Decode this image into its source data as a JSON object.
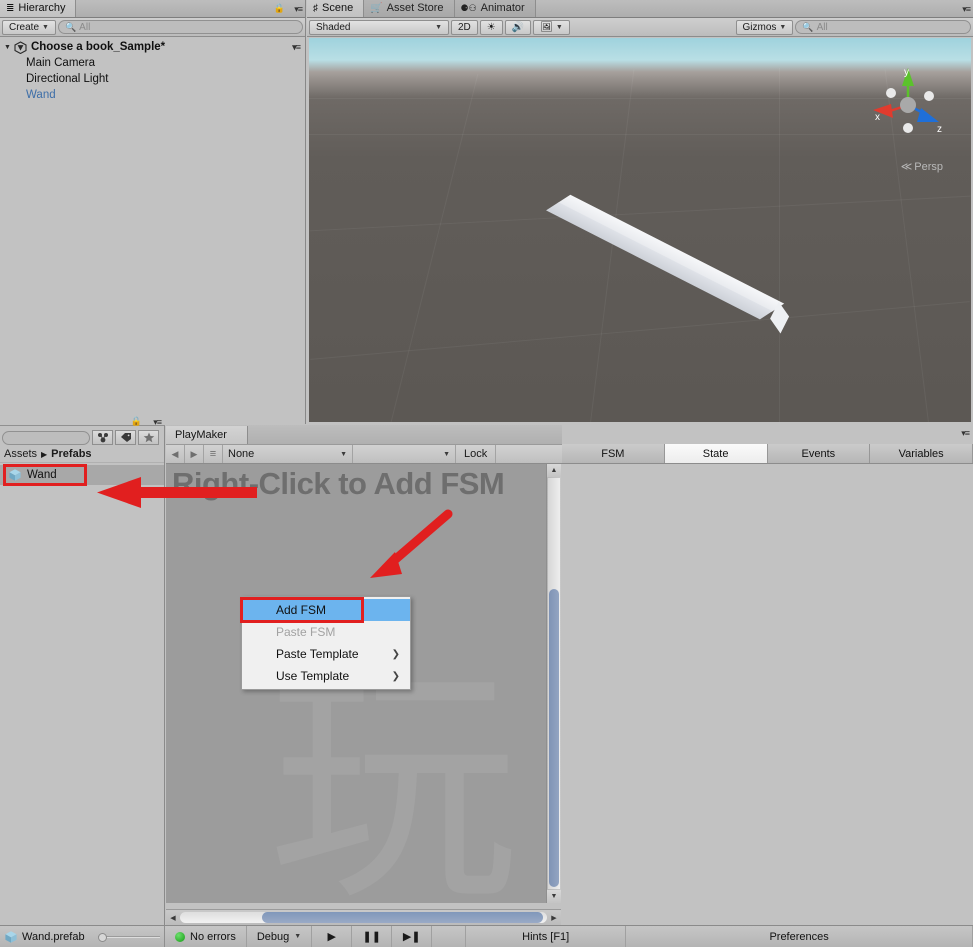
{
  "hierarchy": {
    "tab_label": "Hierarchy",
    "tab_icon": "hierarchy-icon",
    "create_label": "Create",
    "search_placeholder": "All",
    "root_label": "Choose a book_Sample*",
    "items": [
      {
        "label": "Main Camera",
        "kind": "gameobject"
      },
      {
        "label": "Directional Light",
        "kind": "gameobject"
      },
      {
        "label": "Wand",
        "kind": "prefab"
      }
    ]
  },
  "scene": {
    "tabs": [
      {
        "label": "Scene",
        "icon": "scene-icon",
        "active": true
      },
      {
        "label": "Asset Store",
        "icon": "store-icon",
        "active": false
      },
      {
        "label": "Animator",
        "icon": "animator-icon",
        "active": false
      }
    ],
    "toolbar": {
      "draw_mode": "Shaded",
      "two_d": "2D",
      "light_icon": "sun-icon",
      "audio_icon": "speaker-icon",
      "fx_icon": "image-icon",
      "gizmos_label": "Gizmos",
      "search_placeholder": "All"
    },
    "gizmo": {
      "x_label": "x",
      "y_label": "y",
      "z_label": "z",
      "projection_label": "Persp",
      "x_color": "#e03b2e",
      "y_color": "#5bc22b",
      "z_color": "#1f6fd8"
    }
  },
  "project": {
    "search_placeholder": "",
    "icons": [
      "favorite-folder-icon",
      "label-icon",
      "star-icon"
    ],
    "breadcrumb": [
      "Assets",
      "Prefabs"
    ],
    "assets": [
      {
        "label": "Wand",
        "icon": "prefab-cube-icon",
        "selected": true
      }
    ]
  },
  "playmaker": {
    "tab_label": "PlayMaker",
    "toolbar": {
      "back_icon": "arrow-left-icon",
      "forward_icon": "arrow-right-icon",
      "list_icon": "list-icon",
      "selected_object": "None",
      "fsm_dropdown": "",
      "lock_label": "Lock",
      "settings_icon": "preset-icon"
    },
    "graph": {
      "hint_text": "Right-Click to Add FSM",
      "watermark_glyph": "玩"
    },
    "context_menu": {
      "items": [
        {
          "label": "Add FSM",
          "state": "selected",
          "submenu": false
        },
        {
          "label": "Paste FSM",
          "state": "disabled",
          "submenu": false
        },
        {
          "label": "Paste Template",
          "state": "normal",
          "submenu": true
        },
        {
          "label": "Use Template",
          "state": "normal",
          "submenu": true
        }
      ]
    },
    "subtabs": [
      {
        "label": "FSM",
        "active": false
      },
      {
        "label": "State",
        "active": true
      },
      {
        "label": "Events",
        "active": false
      },
      {
        "label": "Variables",
        "active": false
      }
    ]
  },
  "statusbar": {
    "selected_asset": "Wand.prefab",
    "errors_label": "No errors",
    "errors_color": "#19a219",
    "debug_label": "Debug",
    "play_icon": "play-icon",
    "pause_icon": "pause-icon",
    "step_icon": "step-icon",
    "hints_label": "Hints [F1]",
    "preferences_label": "Preferences"
  },
  "annotations": {
    "arrow_color": "#e11f1f",
    "highlight_color": "#e11f1f"
  }
}
